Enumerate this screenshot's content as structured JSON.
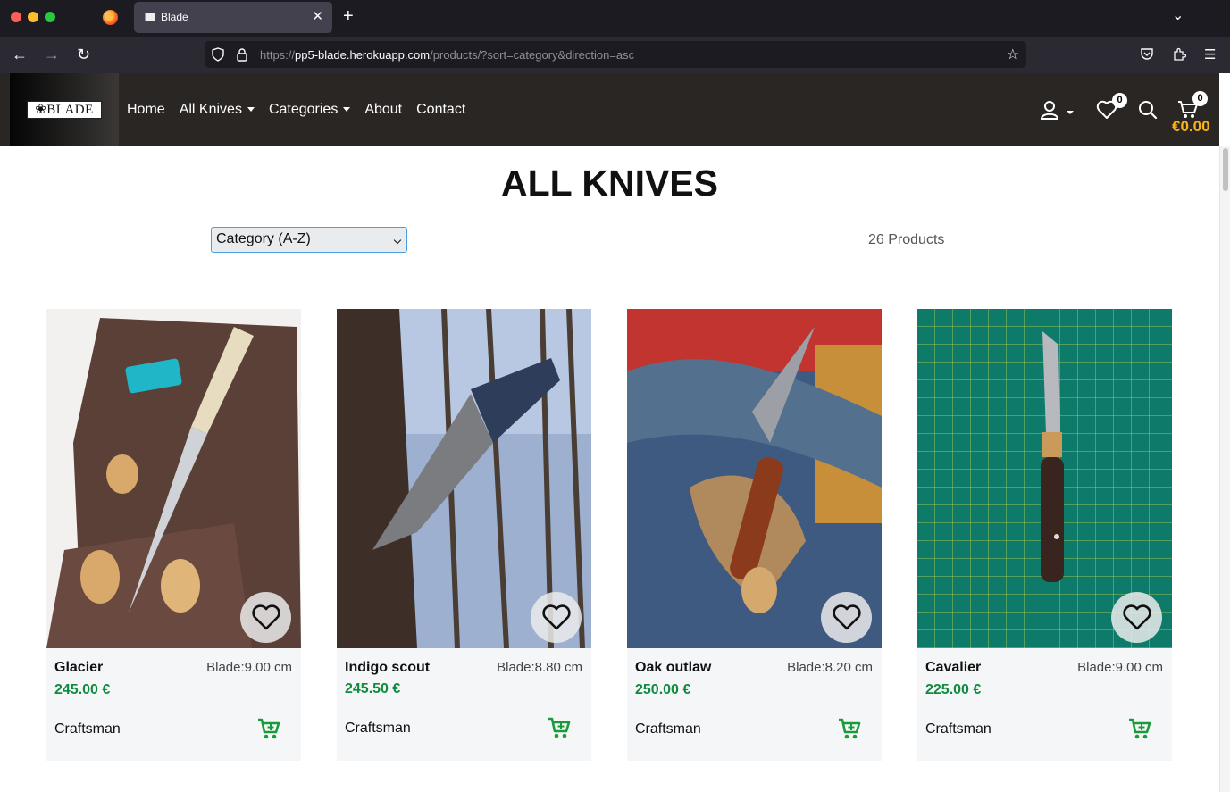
{
  "browser": {
    "tab_title": "Blade",
    "url_domain": "pp5-blade.herokuapp.com",
    "url_prefix": "https://",
    "url_path": "/products/?sort=category&direction=asc"
  },
  "site": {
    "logo_text": "BLADE",
    "nav": [
      {
        "label": "Home"
      },
      {
        "label": "All Knives"
      },
      {
        "label": "Categories"
      },
      {
        "label": "About"
      },
      {
        "label": "Contact"
      }
    ],
    "wishlist_count": "0",
    "cart_count": "0",
    "cart_total": "€0.00"
  },
  "page": {
    "title": "ALL KNIVES",
    "sort_selected": "Category (A-Z)",
    "product_count": "26 Products"
  },
  "products": [
    {
      "name": "Glacier",
      "blade": "Blade:9.00 cm",
      "price": "245.00 €",
      "category": "Craftsman"
    },
    {
      "name": "Indigo scout",
      "blade": "Blade:8.80 cm",
      "price": "245.50 €",
      "category": "Craftsman"
    },
    {
      "name": "Oak outlaw",
      "blade": "Blade:8.20 cm",
      "price": "250.00 €",
      "category": "Craftsman"
    },
    {
      "name": "Cavalier",
      "blade": "Blade:9.00 cm",
      "price": "225.00 €",
      "category": "Craftsman"
    }
  ],
  "colors": {
    "accent_price": "#108a3e",
    "cart_total": "#f9b11b",
    "navbar_bg": "#2a2624"
  }
}
